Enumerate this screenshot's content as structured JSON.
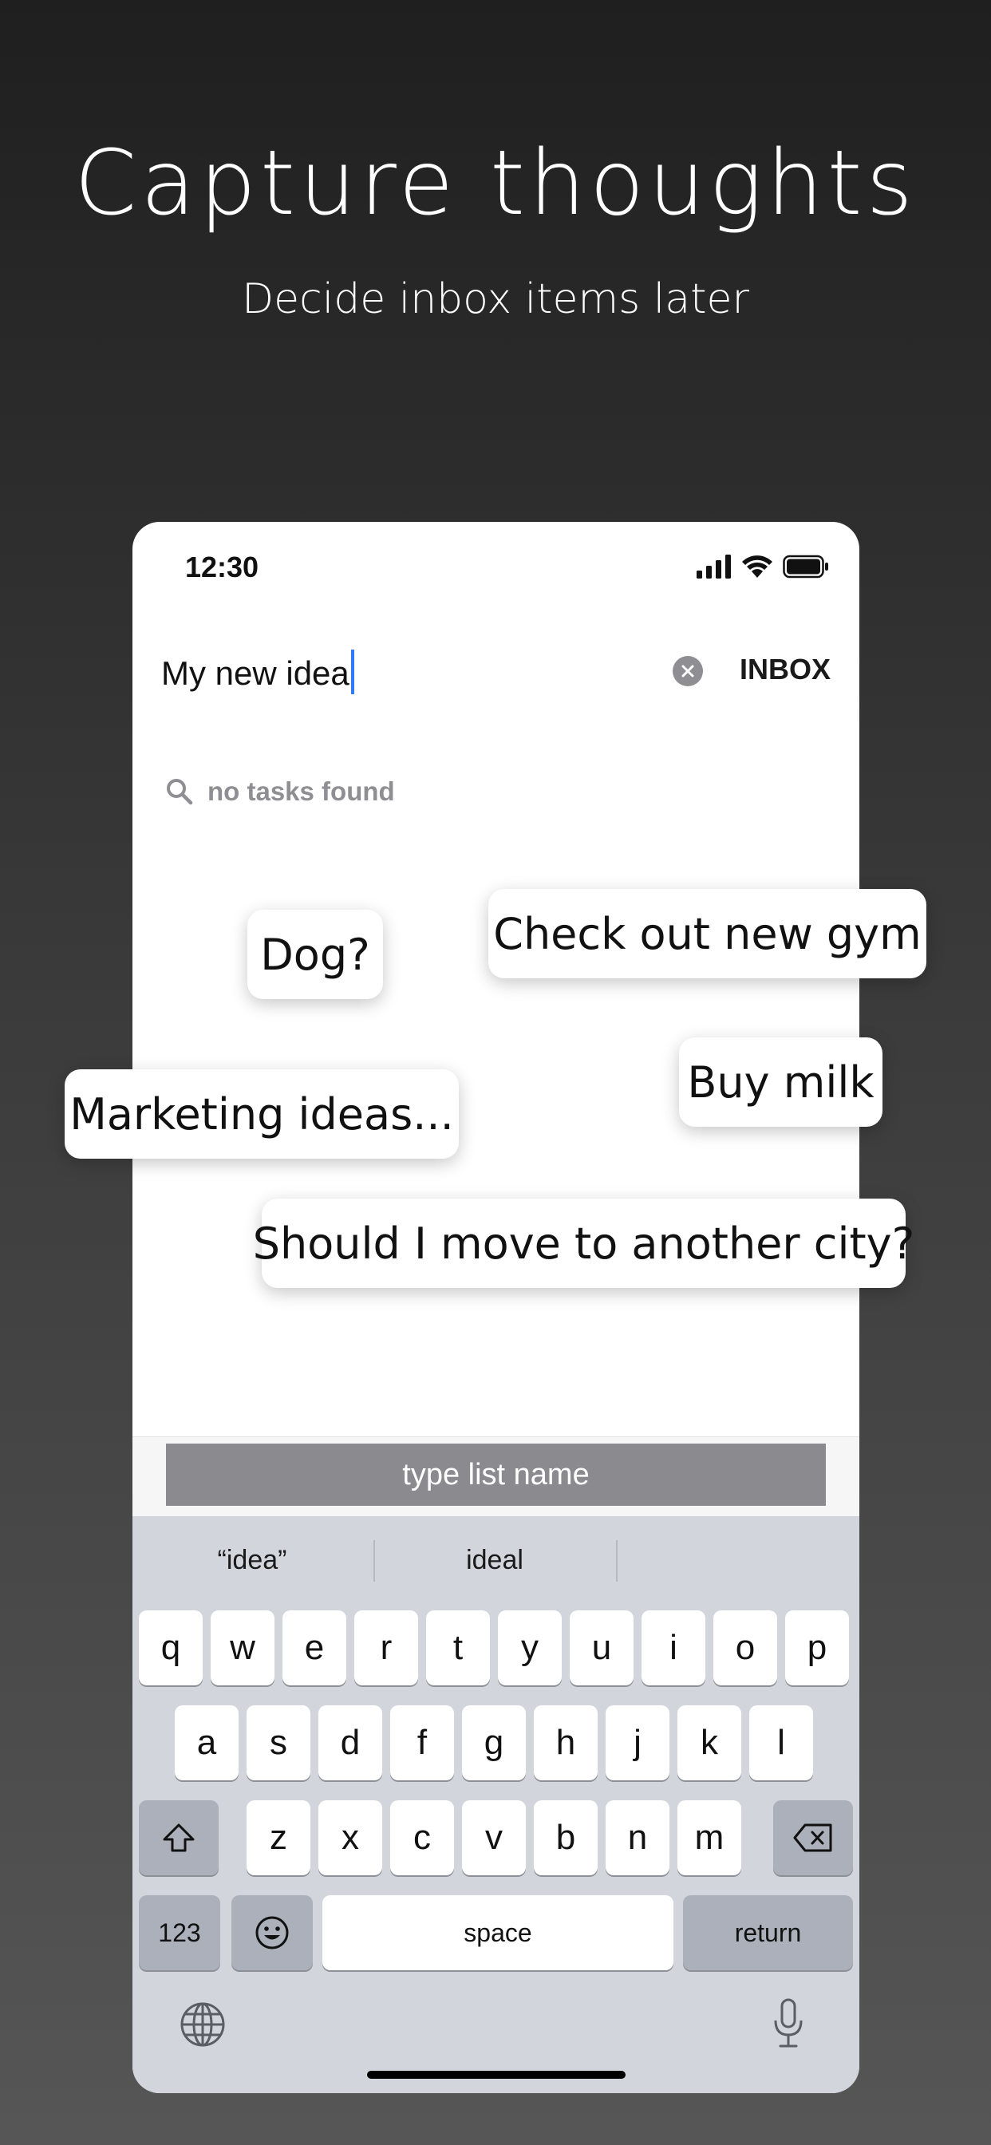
{
  "promo": {
    "headline": "Capture thoughts",
    "subheadline": "Decide inbox items later"
  },
  "status_bar": {
    "time": "12:30",
    "icons": [
      "signal-icon",
      "wifi-icon",
      "battery-icon"
    ]
  },
  "task_input": {
    "value": "My new idea",
    "clear_icon": "clear-icon",
    "inbox_label": "INBOX"
  },
  "search": {
    "icon": "search-icon",
    "empty_text": "no tasks found"
  },
  "list_name": {
    "placeholder": "type list name"
  },
  "keyboard": {
    "suggestions": [
      "“idea”",
      "ideal"
    ],
    "row1": [
      "q",
      "w",
      "e",
      "r",
      "t",
      "y",
      "u",
      "i",
      "o",
      "p"
    ],
    "row2": [
      "a",
      "s",
      "d",
      "f",
      "g",
      "h",
      "j",
      "k",
      "l"
    ],
    "row3": [
      "z",
      "x",
      "c",
      "v",
      "b",
      "n",
      "m"
    ],
    "numbers_label": "123",
    "space_label": "space",
    "return_label": "return",
    "icons": [
      "shift-icon",
      "backspace-icon",
      "emoji-icon",
      "globe-icon",
      "microphone-icon"
    ]
  },
  "thought_bubbles": [
    "Dog?",
    "Check out new gym",
    "Buy milk",
    "Marketing ideas...",
    "Should I move to another city?"
  ],
  "colors": {
    "caret": "#2f7cf6",
    "keyboard_bg": "#d2d5db",
    "list_bar_bg": "#8a8a8f"
  }
}
